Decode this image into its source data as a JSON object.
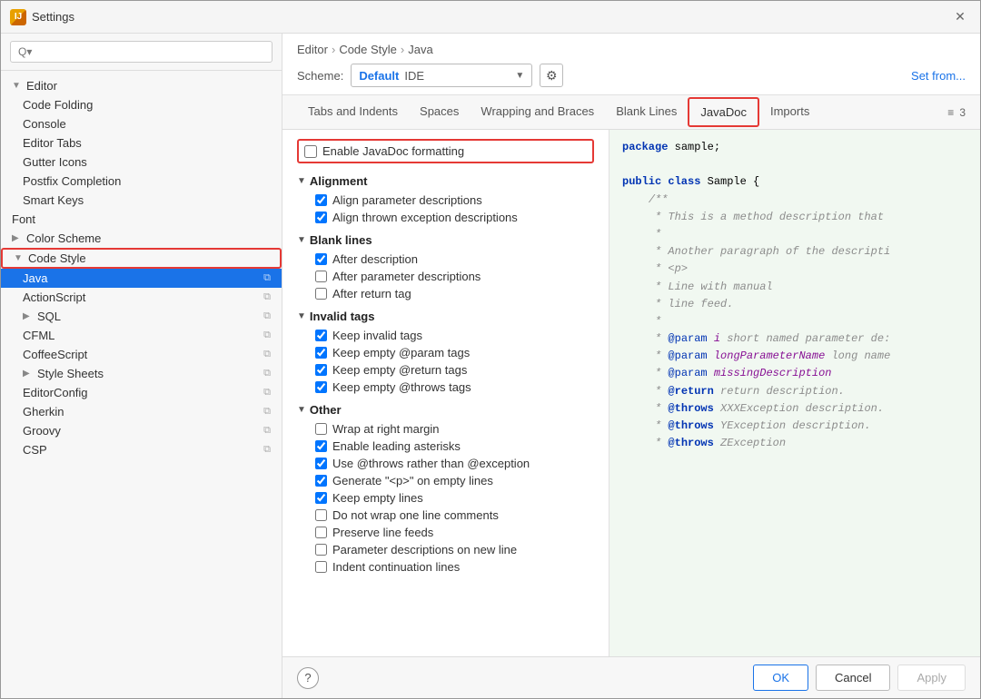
{
  "window": {
    "title": "Settings",
    "app_icon": "IJ"
  },
  "search": {
    "placeholder": "Q▾"
  },
  "sidebar": {
    "items": [
      {
        "id": "editor",
        "label": "Editor",
        "level": 0,
        "type": "parent",
        "expanded": true,
        "hasArrow": false
      },
      {
        "id": "code-folding",
        "label": "Code Folding",
        "level": 1,
        "type": "child",
        "selected": false
      },
      {
        "id": "console",
        "label": "Console",
        "level": 1,
        "type": "child",
        "selected": false
      },
      {
        "id": "editor-tabs",
        "label": "Editor Tabs",
        "level": 1,
        "type": "child",
        "selected": false
      },
      {
        "id": "gutter-icons",
        "label": "Gutter Icons",
        "level": 1,
        "type": "child",
        "selected": false
      },
      {
        "id": "postfix-completion",
        "label": "Postfix Completion",
        "level": 1,
        "type": "child",
        "selected": false
      },
      {
        "id": "smart-keys",
        "label": "Smart Keys",
        "level": 1,
        "type": "child",
        "selected": false
      },
      {
        "id": "font",
        "label": "Font",
        "level": 0,
        "type": "child",
        "selected": false
      },
      {
        "id": "color-scheme",
        "label": "Color Scheme",
        "level": 0,
        "type": "parent-collapsed",
        "expanded": false,
        "hasArrow": true
      },
      {
        "id": "code-style",
        "label": "Code Style",
        "level": 0,
        "type": "parent",
        "expanded": true,
        "hasArrow": true,
        "highlighted": true
      },
      {
        "id": "java",
        "label": "Java",
        "level": 1,
        "type": "child",
        "selected": true,
        "hasCopyIcon": true
      },
      {
        "id": "actionscript",
        "label": "ActionScript",
        "level": 1,
        "type": "child",
        "selected": false,
        "hasCopyIcon": true
      },
      {
        "id": "sql",
        "label": "SQL",
        "level": 1,
        "type": "parent-collapsed",
        "selected": false,
        "hasCopyIcon": true,
        "hasArrow": true
      },
      {
        "id": "cfml",
        "label": "CFML",
        "level": 1,
        "type": "child",
        "selected": false,
        "hasCopyIcon": true
      },
      {
        "id": "coffeescript",
        "label": "CoffeeScript",
        "level": 1,
        "type": "child",
        "selected": false,
        "hasCopyIcon": true
      },
      {
        "id": "style-sheets",
        "label": "Style Sheets",
        "level": 1,
        "type": "parent-collapsed",
        "selected": false,
        "hasCopyIcon": true,
        "hasArrow": true
      },
      {
        "id": "editorconfig",
        "label": "EditorConfig",
        "level": 1,
        "type": "child",
        "selected": false,
        "hasCopyIcon": true
      },
      {
        "id": "gherkin",
        "label": "Gherkin",
        "level": 1,
        "type": "child",
        "selected": false,
        "hasCopyIcon": true
      },
      {
        "id": "groovy",
        "label": "Groovy",
        "level": 1,
        "type": "child",
        "selected": false,
        "hasCopyIcon": true
      },
      {
        "id": "csp",
        "label": "CSP",
        "level": 1,
        "type": "child",
        "selected": false,
        "hasCopyIcon": true
      }
    ]
  },
  "header": {
    "breadcrumb": [
      "Editor",
      ">",
      "Code Style",
      ">",
      "Java"
    ],
    "scheme_label": "Scheme:",
    "scheme_default": "Default",
    "scheme_ide": "IDE",
    "set_from_label": "Set from..."
  },
  "tabs": {
    "items": [
      {
        "id": "tabs-and-indents",
        "label": "Tabs and Indents",
        "active": false
      },
      {
        "id": "spaces",
        "label": "Spaces",
        "active": false
      },
      {
        "id": "wrapping-and-braces",
        "label": "Wrapping and Braces",
        "active": false
      },
      {
        "id": "blank-lines",
        "label": "Blank Lines",
        "active": false
      },
      {
        "id": "javadoc",
        "label": "JavaDoc",
        "active": true,
        "highlighted": true
      },
      {
        "id": "imports",
        "label": "Imports",
        "active": false
      }
    ],
    "overflow_count": "≡3"
  },
  "options": {
    "enable_javadoc": {
      "label": "Enable JavaDoc formatting",
      "checked": false
    },
    "sections": [
      {
        "id": "alignment",
        "label": "Alignment",
        "expanded": true,
        "items": [
          {
            "id": "align-param",
            "label": "Align parameter descriptions",
            "checked": true
          },
          {
            "id": "align-throws",
            "label": "Align thrown exception descriptions",
            "checked": true
          }
        ]
      },
      {
        "id": "blank-lines",
        "label": "Blank lines",
        "expanded": true,
        "items": [
          {
            "id": "after-desc",
            "label": "After description",
            "checked": true
          },
          {
            "id": "after-param",
            "label": "After parameter descriptions",
            "checked": false
          },
          {
            "id": "after-return",
            "label": "After return tag",
            "checked": false
          }
        ]
      },
      {
        "id": "invalid-tags",
        "label": "Invalid tags",
        "expanded": true,
        "items": [
          {
            "id": "keep-invalid",
            "label": "Keep invalid tags",
            "checked": true
          },
          {
            "id": "keep-empty-param",
            "label": "Keep empty @param tags",
            "checked": true
          },
          {
            "id": "keep-empty-return",
            "label": "Keep empty @return tags",
            "checked": true
          },
          {
            "id": "keep-empty-throws",
            "label": "Keep empty @throws tags",
            "checked": true
          }
        ]
      },
      {
        "id": "other",
        "label": "Other",
        "expanded": true,
        "items": [
          {
            "id": "wrap-right",
            "label": "Wrap at right margin",
            "checked": false
          },
          {
            "id": "enable-asterisks",
            "label": "Enable leading asterisks",
            "checked": true
          },
          {
            "id": "use-throws",
            "label": "Use @throws rather than @exception",
            "checked": true
          },
          {
            "id": "generate-p",
            "label": "Generate \"<p>\" on empty lines",
            "checked": true
          },
          {
            "id": "keep-empty-lines",
            "label": "Keep empty lines",
            "checked": true
          },
          {
            "id": "no-wrap-one-line",
            "label": "Do not wrap one line comments",
            "checked": false
          },
          {
            "id": "preserve-feeds",
            "label": "Preserve line feeds",
            "checked": false
          },
          {
            "id": "param-new-line",
            "label": "Parameter descriptions on new line",
            "checked": false
          },
          {
            "id": "indent-continuation",
            "label": "Indent continuation lines",
            "checked": false
          }
        ]
      }
    ]
  },
  "code_preview": {
    "lines": [
      "package sample;",
      "",
      "public class Sample {",
      "    /**",
      "     * This is a method description that",
      "     *",
      "     * Another paragraph of the descripti",
      "     * <p>",
      "     * Line with manual",
      "     * line feed.",
      "     *",
      "     * @param i short named parameter de:",
      "     * @param longParameterName long name",
      "     * @param missingDescription",
      "     * @return return description.",
      "     * @throws XXXException description.",
      "     * @throws YException description.",
      "     * @throws ZException"
    ]
  },
  "bottom": {
    "ok_label": "OK",
    "cancel_label": "Cancel",
    "apply_label": "Apply",
    "help_icon": "?"
  }
}
